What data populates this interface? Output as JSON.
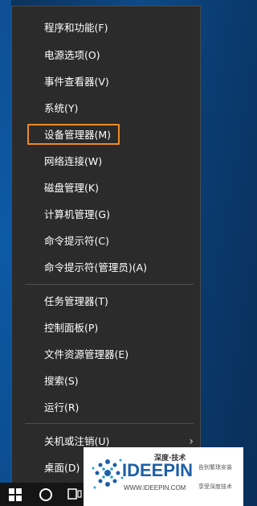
{
  "menu": {
    "items": [
      {
        "label": "程序和功能(F)"
      },
      {
        "label": "电源选项(O)"
      },
      {
        "label": "事件查看器(V)"
      },
      {
        "label": "系统(Y)"
      },
      {
        "label": "设备管理器(M)"
      },
      {
        "label": "网络连接(W)"
      },
      {
        "label": "磁盘管理(K)"
      },
      {
        "label": "计算机管理(G)"
      },
      {
        "label": "命令提示符(C)"
      },
      {
        "label": "命令提示符(管理员)(A)"
      },
      {
        "label": "任务管理器(T)"
      },
      {
        "label": "控制面板(P)"
      },
      {
        "label": "文件资源管理器(E)"
      },
      {
        "label": "搜索(S)"
      },
      {
        "label": "运行(R)"
      },
      {
        "label": "关机或注销(U)"
      },
      {
        "label": "桌面(D)"
      }
    ],
    "highlight_color": "#f08a24",
    "shutdown_chevron": "›"
  },
  "taskbar": {
    "icons": [
      "windows-start-icon",
      "cortana-icon",
      "task-view-icon"
    ]
  },
  "watermark": {
    "title": "深度·技术",
    "brand": "IDEEPIN",
    "url": "WWW.IDEEPIN.COM",
    "slogan1": "告别繁琐安装",
    "slogan2": "享受深度技术"
  }
}
